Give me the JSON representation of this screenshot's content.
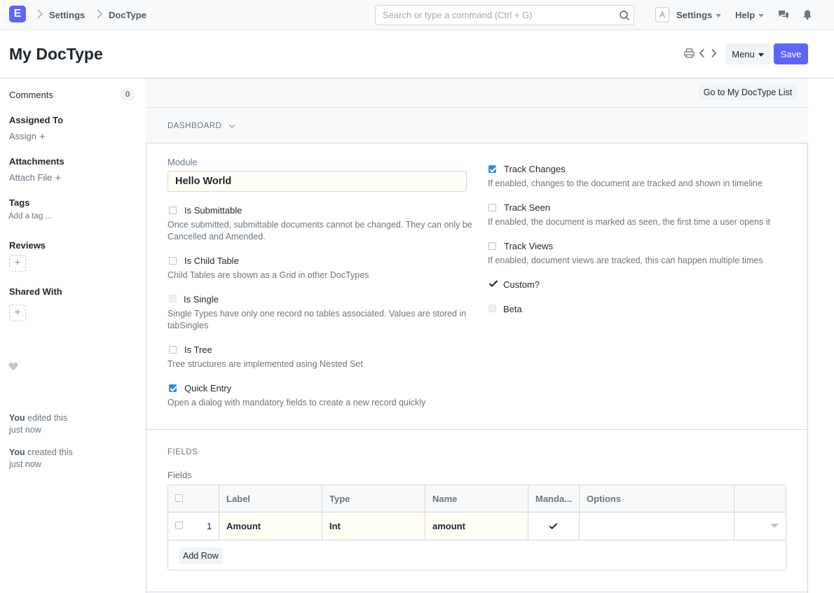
{
  "navbar": {
    "logo_letter": "E",
    "breadcrumbs": [
      "Settings",
      "DocType"
    ],
    "search_placeholder": "Search or type a command (Ctrl + G)",
    "avatar_letter": "A",
    "settings_label": "Settings",
    "help_label": "Help"
  },
  "page": {
    "title": "My DocType",
    "menu_label": "Menu",
    "save_label": "Save",
    "accent_color": "#5e64ff"
  },
  "sidebar": {
    "comments_label": "Comments",
    "comments_count": "0",
    "assigned_label": "Assigned To",
    "assign_link": "Assign",
    "attachments_label": "Attachments",
    "attach_link": "Attach File",
    "tags_label": "Tags",
    "add_tag_link": "Add a tag ...",
    "reviews_label": "Reviews",
    "shared_label": "Shared With",
    "timeline": [
      {
        "user": "You",
        "action": "edited this",
        "when": "just now"
      },
      {
        "user": "You",
        "action": "created this",
        "when": "just now"
      }
    ]
  },
  "form": {
    "goto_list_label": "Go to My DocType List",
    "dashboard_label": "DASHBOARD",
    "module_label": "Module",
    "module_value": "Hello World",
    "left_checks": [
      {
        "label": "Is Submittable",
        "checked": false,
        "desc": "Once submitted, submittable documents cannot be changed. They can only be Cancelled and Amended."
      },
      {
        "label": "Is Child Table",
        "checked": false,
        "desc": "Child Tables are shown as a Grid in other DocTypes"
      },
      {
        "label": "Is Single",
        "checked": false,
        "disabled": true,
        "desc": "Single Types have only one record no tables associated. Values are stored in tabSingles"
      },
      {
        "label": "Is Tree",
        "checked": false,
        "desc": "Tree structures are implemented using Nested Set"
      },
      {
        "label": "Quick Entry",
        "checked": true,
        "desc": "Open a dialog with mandatory fields to create a new record quickly"
      }
    ],
    "right_checks": [
      {
        "label": "Track Changes",
        "checked": true,
        "desc": "If enabled, changes to the document are tracked and shown in timeline"
      },
      {
        "label": "Track Seen",
        "checked": false,
        "desc": "If enabled, the document is marked as seen, the first time a user opens it"
      },
      {
        "label": "Track Views",
        "checked": false,
        "desc": "If enabled, document views are tracked, this can happen multiple times"
      },
      {
        "label": "Custom?",
        "checked": true,
        "readonly": true
      },
      {
        "label": "Beta",
        "checked": false,
        "disabled": true
      }
    ],
    "fields_section_label": "FIELDS",
    "fields_label": "Fields",
    "grid": {
      "columns": [
        "Label",
        "Type",
        "Name",
        "Manda...",
        "Options"
      ],
      "rows": [
        {
          "idx": "1",
          "label": "Amount",
          "type": "Int",
          "name": "amount",
          "mandatory": true,
          "options": ""
        }
      ],
      "add_row_label": "Add Row"
    }
  }
}
